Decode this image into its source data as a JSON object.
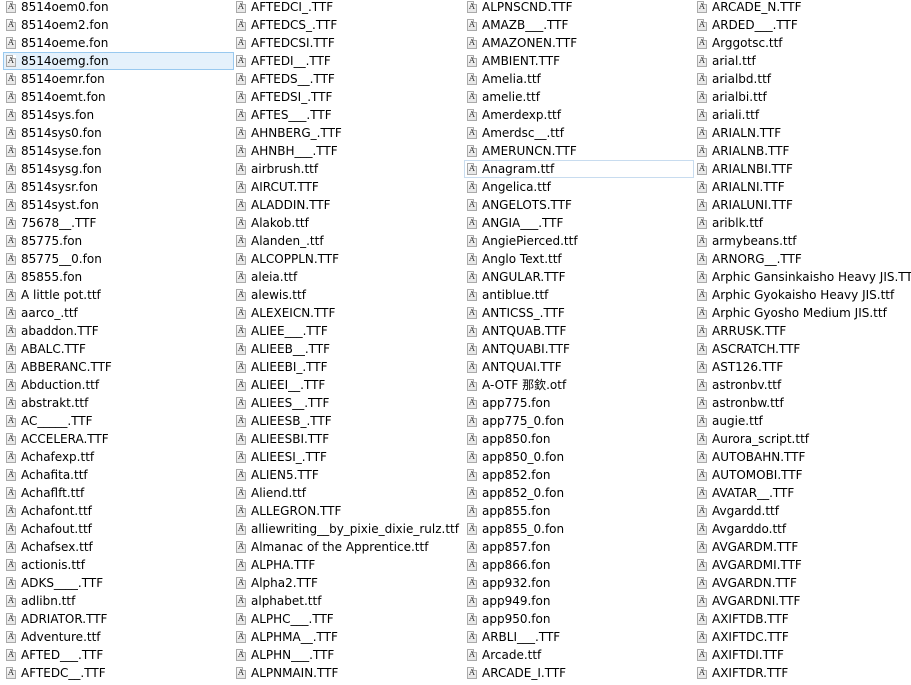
{
  "columns": [
    {
      "items": [
        {
          "name": "8514oem0.fon",
          "icon": "font-file-icon"
        },
        {
          "name": "8514oem2.fon",
          "icon": "font-file-icon"
        },
        {
          "name": "8514oeme.fon",
          "icon": "font-file-icon"
        },
        {
          "name": "8514oemg.fon",
          "icon": "font-file-icon",
          "selected": true
        },
        {
          "name": "8514oemr.fon",
          "icon": "font-file-icon"
        },
        {
          "name": "8514oemt.fon",
          "icon": "font-file-icon"
        },
        {
          "name": "8514sys.fon",
          "icon": "font-file-icon"
        },
        {
          "name": "8514sys0.fon",
          "icon": "font-file-icon"
        },
        {
          "name": "8514syse.fon",
          "icon": "font-file-icon"
        },
        {
          "name": "8514sysg.fon",
          "icon": "font-file-icon"
        },
        {
          "name": "8514sysr.fon",
          "icon": "font-file-icon"
        },
        {
          "name": "8514syst.fon",
          "icon": "font-file-icon"
        },
        {
          "name": "75678__.TTF",
          "icon": "font-file-icon"
        },
        {
          "name": "85775.fon",
          "icon": "font-file-icon"
        },
        {
          "name": "85775__0.fon",
          "icon": "font-file-icon"
        },
        {
          "name": "85855.fon",
          "icon": "font-file-icon"
        },
        {
          "name": "A little pot.ttf",
          "icon": "font-file-icon"
        },
        {
          "name": "aarco_.ttf",
          "icon": "font-file-icon"
        },
        {
          "name": "abaddon.TTF",
          "icon": "font-file-icon"
        },
        {
          "name": "ABALC.TTF",
          "icon": "font-file-icon"
        },
        {
          "name": "ABBERANC.TTF",
          "icon": "font-file-icon"
        },
        {
          "name": "Abduction.ttf",
          "icon": "font-file-icon"
        },
        {
          "name": "abstrakt.ttf",
          "icon": "font-file-icon"
        },
        {
          "name": "AC_____.TTF",
          "icon": "font-file-icon"
        },
        {
          "name": "ACCELERA.TTF",
          "icon": "font-file-icon"
        },
        {
          "name": "Achafexp.ttf",
          "icon": "font-file-icon"
        },
        {
          "name": "Achafita.ttf",
          "icon": "font-file-icon"
        },
        {
          "name": "Achaflft.ttf",
          "icon": "font-file-icon"
        },
        {
          "name": "Achafont.ttf",
          "icon": "font-file-icon"
        },
        {
          "name": "Achafout.ttf",
          "icon": "font-file-icon"
        },
        {
          "name": "Achafsex.ttf",
          "icon": "font-file-icon"
        },
        {
          "name": "actionis.ttf",
          "icon": "font-file-icon"
        },
        {
          "name": "ADKS____.TTF",
          "icon": "font-file-icon"
        },
        {
          "name": "adlibn.ttf",
          "icon": "font-file-icon"
        },
        {
          "name": "ADRIATOR.TTF",
          "icon": "font-file-icon"
        },
        {
          "name": "Adventure.ttf",
          "icon": "font-file-icon"
        },
        {
          "name": "AFTED___.TTF",
          "icon": "font-file-icon"
        },
        {
          "name": "AFTEDC__.TTF",
          "icon": "font-file-icon"
        }
      ]
    },
    {
      "items": [
        {
          "name": "AFTEDCI_.TTF",
          "icon": "font-file-icon"
        },
        {
          "name": "AFTEDCS_.TTF",
          "icon": "font-file-icon"
        },
        {
          "name": "AFTEDCSI.TTF",
          "icon": "font-file-icon"
        },
        {
          "name": "AFTEDI__.TTF",
          "icon": "font-file-icon"
        },
        {
          "name": "AFTEDS__.TTF",
          "icon": "font-file-icon"
        },
        {
          "name": "AFTEDSI_.TTF",
          "icon": "font-file-icon"
        },
        {
          "name": "AFTES___.TTF",
          "icon": "font-file-icon"
        },
        {
          "name": "AHNBERG_.TTF",
          "icon": "font-file-icon"
        },
        {
          "name": "AHNBH___.TTF",
          "icon": "font-file-icon"
        },
        {
          "name": "airbrush.ttf",
          "icon": "font-file-icon"
        },
        {
          "name": "AIRCUT.TTF",
          "icon": "font-file-icon"
        },
        {
          "name": "ALADDIN.TTF",
          "icon": "font-file-icon"
        },
        {
          "name": "Alakob.ttf",
          "icon": "font-file-icon"
        },
        {
          "name": "Alanden_.ttf",
          "icon": "font-file-icon"
        },
        {
          "name": "ALCOPPLN.TTF",
          "icon": "font-file-icon"
        },
        {
          "name": "aleia.ttf",
          "icon": "font-file-icon"
        },
        {
          "name": "alewis.ttf",
          "icon": "font-file-icon"
        },
        {
          "name": "ALEXEICN.TTF",
          "icon": "font-file-icon"
        },
        {
          "name": "ALIEE___.TTF",
          "icon": "font-file-icon"
        },
        {
          "name": "ALIEEB__.TTF",
          "icon": "font-file-icon"
        },
        {
          "name": "ALIEEBI_.TTF",
          "icon": "font-file-icon"
        },
        {
          "name": "ALIEEI__.TTF",
          "icon": "font-file-icon"
        },
        {
          "name": "ALIEES__.TTF",
          "icon": "font-file-icon"
        },
        {
          "name": "ALIEESB_.TTF",
          "icon": "font-file-icon"
        },
        {
          "name": "ALIEESBI.TTF",
          "icon": "font-file-icon"
        },
        {
          "name": "ALIEESI_.TTF",
          "icon": "font-file-icon"
        },
        {
          "name": "ALIEN5.TTF",
          "icon": "font-file-icon"
        },
        {
          "name": "Aliend.ttf",
          "icon": "font-file-icon"
        },
        {
          "name": "ALLEGRON.TTF",
          "icon": "font-file-icon"
        },
        {
          "name": "alliewriting__by_pixie_dixie_rulz.ttf",
          "icon": "font-file-icon"
        },
        {
          "name": "Almanac of the Apprentice.ttf",
          "icon": "font-file-icon"
        },
        {
          "name": "ALPHA.TTF",
          "icon": "font-file-icon"
        },
        {
          "name": "Alpha2.TTF",
          "icon": "font-file-icon"
        },
        {
          "name": "alphabet.ttf",
          "icon": "font-file-icon"
        },
        {
          "name": "ALPHC___.TTF",
          "icon": "font-file-icon"
        },
        {
          "name": "ALPHMA__.TTF",
          "icon": "font-file-icon"
        },
        {
          "name": "ALPHN___.TTF",
          "icon": "font-file-icon"
        },
        {
          "name": "ALPNMAIN.TTF",
          "icon": "font-file-icon"
        }
      ]
    },
    {
      "items": [
        {
          "name": "ALPNSCND.TTF",
          "icon": "font-file-icon"
        },
        {
          "name": "AMAZB___.TTF",
          "icon": "font-file-icon"
        },
        {
          "name": "AMAZONEN.TTF",
          "icon": "font-file-icon"
        },
        {
          "name": "AMBIENT.TTF",
          "icon": "font-file-icon"
        },
        {
          "name": "Amelia.ttf",
          "icon": "font-file-icon"
        },
        {
          "name": "amelie.ttf",
          "icon": "font-file-icon"
        },
        {
          "name": "Amerdexp.ttf",
          "icon": "font-file-icon"
        },
        {
          "name": "Amerdsc__.ttf",
          "icon": "font-file-icon"
        },
        {
          "name": "AMERUNCN.TTF",
          "icon": "font-file-icon"
        },
        {
          "name": "Anagram.ttf",
          "icon": "font-file-icon",
          "focused": true
        },
        {
          "name": "Angelica.ttf",
          "icon": "font-file-icon"
        },
        {
          "name": "ANGELOTS.TTF",
          "icon": "font-file-icon"
        },
        {
          "name": "ANGIA___.TTF",
          "icon": "font-file-icon"
        },
        {
          "name": "AngiePierced.ttf",
          "icon": "font-file-icon"
        },
        {
          "name": "Anglo Text.ttf",
          "icon": "font-file-icon"
        },
        {
          "name": "ANGULAR.TTF",
          "icon": "font-file-icon"
        },
        {
          "name": "antiblue.ttf",
          "icon": "font-file-icon"
        },
        {
          "name": "ANTICSS_.TTF",
          "icon": "font-file-icon"
        },
        {
          "name": "ANTQUAB.TTF",
          "icon": "font-file-icon"
        },
        {
          "name": "ANTQUABI.TTF",
          "icon": "font-file-icon"
        },
        {
          "name": "ANTQUAI.TTF",
          "icon": "font-file-icon"
        },
        {
          "name": "A-OTF 那欽.otf",
          "icon": "font-file-icon"
        },
        {
          "name": "app775.fon",
          "icon": "font-file-icon"
        },
        {
          "name": "app775_0.fon",
          "icon": "font-file-icon"
        },
        {
          "name": "app850.fon",
          "icon": "font-file-icon"
        },
        {
          "name": "app850_0.fon",
          "icon": "font-file-icon"
        },
        {
          "name": "app852.fon",
          "icon": "font-file-icon"
        },
        {
          "name": "app852_0.fon",
          "icon": "font-file-icon"
        },
        {
          "name": "app855.fon",
          "icon": "font-file-icon"
        },
        {
          "name": "app855_0.fon",
          "icon": "font-file-icon"
        },
        {
          "name": "app857.fon",
          "icon": "font-file-icon"
        },
        {
          "name": "app866.fon",
          "icon": "font-file-icon"
        },
        {
          "name": "app932.fon",
          "icon": "font-file-icon"
        },
        {
          "name": "app949.fon",
          "icon": "font-file-icon"
        },
        {
          "name": "app950.fon",
          "icon": "font-file-icon"
        },
        {
          "name": "ARBLI___.TTF",
          "icon": "font-file-icon"
        },
        {
          "name": "Arcade.ttf",
          "icon": "font-file-icon"
        },
        {
          "name": "ARCADE_I.TTF",
          "icon": "font-file-icon"
        }
      ]
    },
    {
      "items": [
        {
          "name": "ARCADE_N.TTF",
          "icon": "font-file-icon"
        },
        {
          "name": "ARDED___.TTF",
          "icon": "font-file-icon"
        },
        {
          "name": "Arggotsc.ttf",
          "icon": "font-file-icon"
        },
        {
          "name": "arial.ttf",
          "icon": "font-file-icon"
        },
        {
          "name": "arialbd.ttf",
          "icon": "font-file-icon"
        },
        {
          "name": "arialbi.ttf",
          "icon": "font-file-icon"
        },
        {
          "name": "ariali.ttf",
          "icon": "font-file-icon"
        },
        {
          "name": "ARIALN.TTF",
          "icon": "font-file-icon"
        },
        {
          "name": "ARIALNB.TTF",
          "icon": "font-file-icon"
        },
        {
          "name": "ARIALNBI.TTF",
          "icon": "font-file-icon"
        },
        {
          "name": "ARIALNI.TTF",
          "icon": "font-file-icon"
        },
        {
          "name": "ARIALUNI.TTF",
          "icon": "font-file-icon"
        },
        {
          "name": "ariblk.ttf",
          "icon": "font-file-icon"
        },
        {
          "name": "armybeans.ttf",
          "icon": "font-file-icon"
        },
        {
          "name": "ARNORG__.TTF",
          "icon": "font-file-icon"
        },
        {
          "name": "Arphic Gansinkaisho Heavy JIS.TTF",
          "icon": "font-file-icon"
        },
        {
          "name": "Arphic Gyokaisho Heavy JIS.ttf",
          "icon": "font-file-icon"
        },
        {
          "name": "Arphic Gyosho Medium JIS.ttf",
          "icon": "font-file-icon"
        },
        {
          "name": "ARRUSK.TTF",
          "icon": "font-file-icon"
        },
        {
          "name": "ASCRATCH.TTF",
          "icon": "font-file-icon"
        },
        {
          "name": "AST126.TTF",
          "icon": "font-file-icon"
        },
        {
          "name": "astronbv.ttf",
          "icon": "font-file-icon"
        },
        {
          "name": "astronbw.ttf",
          "icon": "font-file-icon"
        },
        {
          "name": "augie.ttf",
          "icon": "font-file-icon"
        },
        {
          "name": "Aurora_script.ttf",
          "icon": "font-file-icon"
        },
        {
          "name": "AUTOBAHN.TTF",
          "icon": "font-file-icon"
        },
        {
          "name": "AUTOMOBI.TTF",
          "icon": "font-file-icon"
        },
        {
          "name": "AVATAR__.TTF",
          "icon": "font-file-icon"
        },
        {
          "name": "Avgardd.ttf",
          "icon": "font-file-icon"
        },
        {
          "name": "Avgarddo.ttf",
          "icon": "font-file-icon"
        },
        {
          "name": "AVGARDM.TTF",
          "icon": "font-file-icon"
        },
        {
          "name": "AVGARDMI.TTF",
          "icon": "font-file-icon"
        },
        {
          "name": "AVGARDN.TTF",
          "icon": "font-file-icon"
        },
        {
          "name": "AVGARDNI.TTF",
          "icon": "font-file-icon"
        },
        {
          "name": "AXIFTDB.TTF",
          "icon": "font-file-icon"
        },
        {
          "name": "AXIFTDC.TTF",
          "icon": "font-file-icon"
        },
        {
          "name": "AXIFTDI.TTF",
          "icon": "font-file-icon"
        },
        {
          "name": "AXIFTDR.TTF",
          "icon": "font-file-icon"
        }
      ]
    }
  ]
}
